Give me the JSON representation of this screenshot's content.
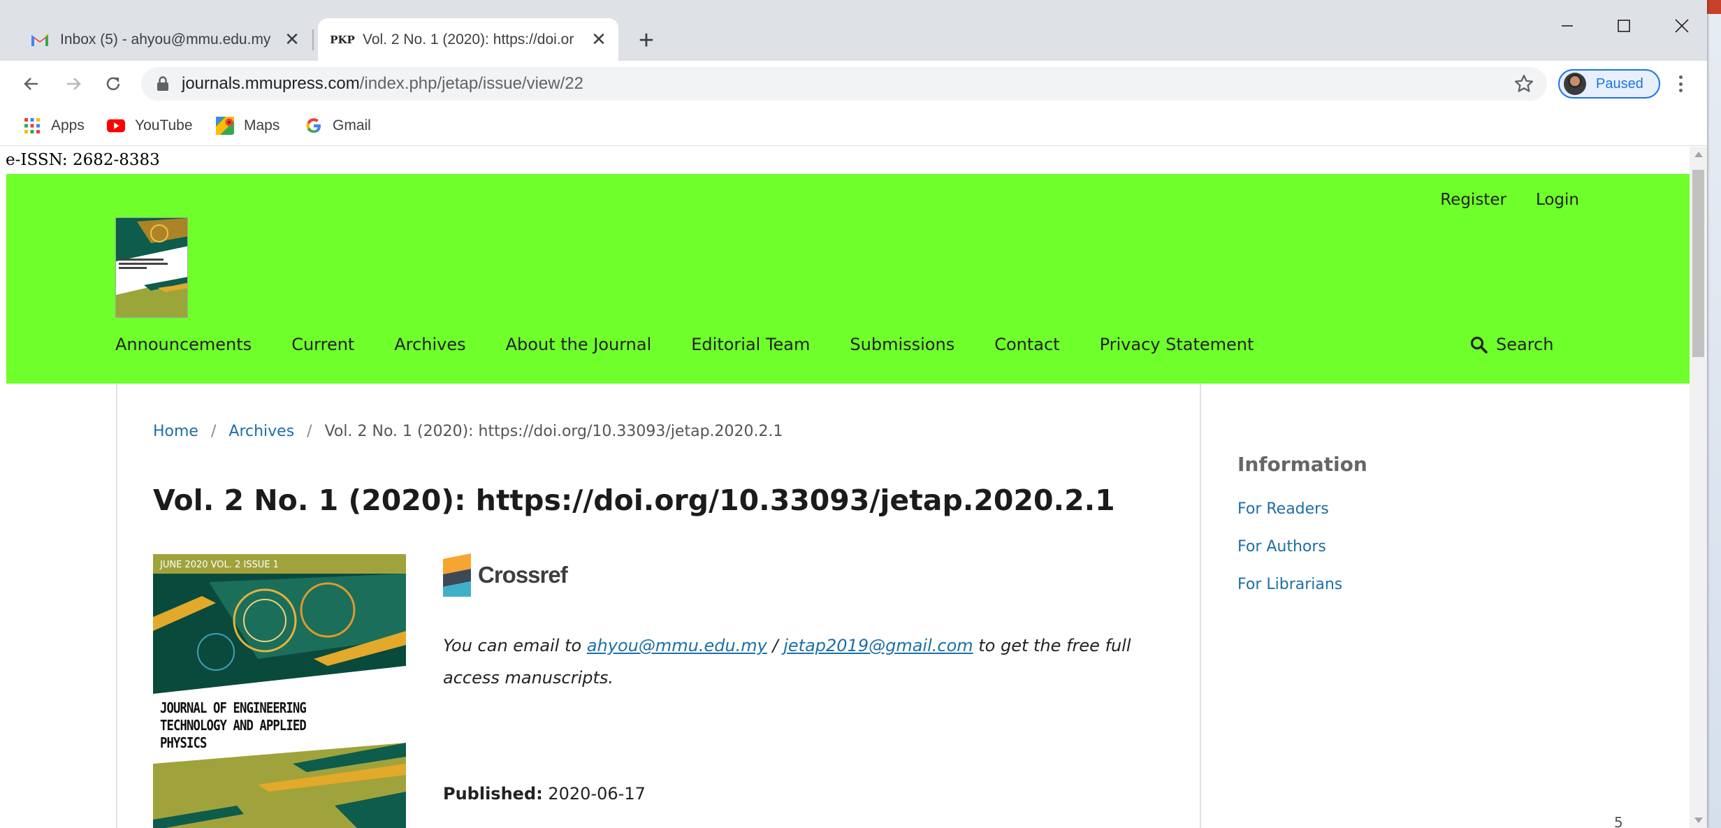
{
  "browser": {
    "tabs": [
      {
        "label": "Inbox (5) - ahyou@mmu.edu.my",
        "favicon": "gmail-icon"
      },
      {
        "label": "Vol. 2 No. 1 (2020): https://doi.or",
        "favicon": "pkp-icon",
        "favicon_text": "PKP"
      }
    ],
    "address": {
      "domain": "journals.mmupress.com",
      "path": "/index.php/jetap/issue/view/22"
    },
    "profile_label": "Paused",
    "bookmarks": [
      {
        "label": "Apps",
        "icon": "apps-grid-icon"
      },
      {
        "label": "YouTube",
        "icon": "youtube-icon"
      },
      {
        "label": "Maps",
        "icon": "maps-icon"
      },
      {
        "label": "Gmail",
        "icon": "google-icon"
      }
    ]
  },
  "page": {
    "issn": "e-ISSN: 2682-8383",
    "user_links": {
      "register": "Register",
      "login": "Login"
    },
    "nav": [
      "Announcements",
      "Current",
      "Archives",
      "About the Journal",
      "Editorial Team",
      "Submissions",
      "Contact",
      "Privacy Statement"
    ],
    "search_label": "Search",
    "breadcrumb": {
      "home": "Home",
      "archives": "Archives",
      "current": "Vol. 2 No. 1 (2020): https://doi.org/10.33093/jetap.2020.2.1"
    },
    "title": "Vol. 2 No. 1 (2020): https://doi.org/10.33093/jetap.2020.2.1",
    "cover": {
      "banner": "JUNE 2020 VOL. 2 ISSUE 1",
      "journal_lines": [
        "JOURNAL OF ENGINEERING",
        "TECHNOLOGY AND APPLIED",
        "PHYSICS"
      ]
    },
    "crossref_label": "Crossref",
    "email_note": {
      "prefix": "You can email to ",
      "email1": "ahyou@mmu.edu.my",
      "middle": " / ",
      "email2": "jetap2019@gmail.com",
      "suffix": " to get the free full access manuscripts."
    },
    "published": {
      "label": "Published:",
      "value": "2020-06-17"
    },
    "sidebar": {
      "title": "Information",
      "links": [
        "For Readers",
        "For Authors",
        "For Librarians"
      ]
    },
    "page_number": "5"
  },
  "colors": {
    "header_green": "#6fff2b",
    "link_blue": "#1d6fa5",
    "chrome_tab_bg": "#dee1e6"
  }
}
